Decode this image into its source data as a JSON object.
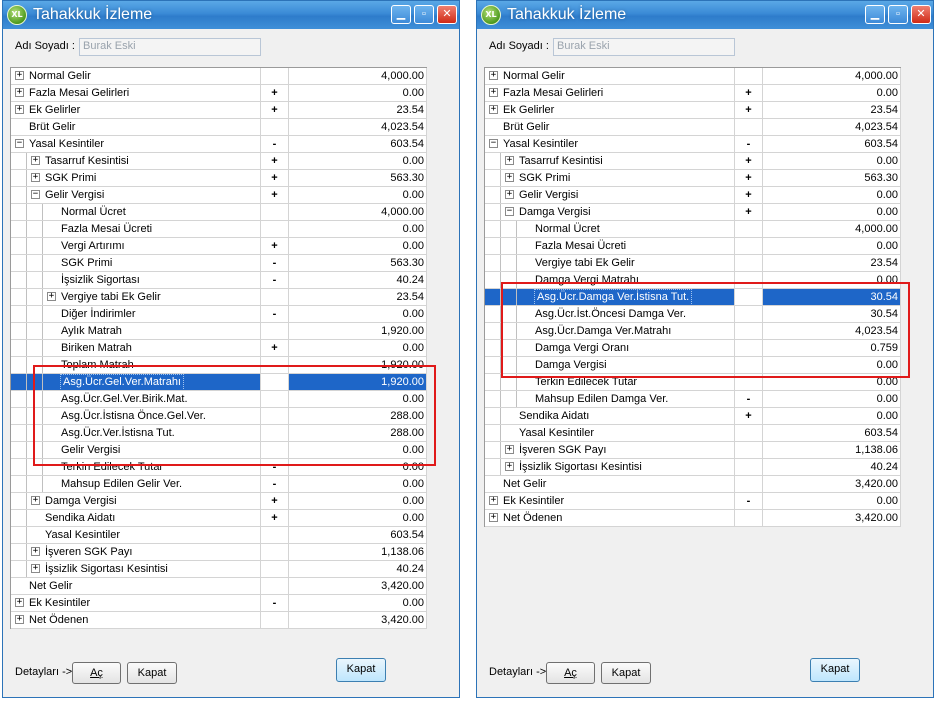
{
  "windows": [
    {
      "title": "Tahakkuk İzleme",
      "name_label": "Adı Soyadı :",
      "name_value": "Burak Eski",
      "footer_label": "Detayları ->",
      "btn_open": "Aç",
      "btn_collapse": "Kapat",
      "btn_close": "Kapat",
      "rows": [
        {
          "name": "Normal Gelir",
          "sign": "",
          "value": "4,000.00",
          "level": 0,
          "exp": "+"
        },
        {
          "name": "Fazla Mesai Gelirleri",
          "sign": "+",
          "value": "0.00",
          "level": 0,
          "exp": "+"
        },
        {
          "name": "Ek Gelirler",
          "sign": "+",
          "value": "23.54",
          "level": 0,
          "exp": "+"
        },
        {
          "name": "Brüt Gelir",
          "sign": "",
          "value": "4,023.54",
          "level": 0,
          "exp": ""
        },
        {
          "name": "Yasal Kesintiler",
          "sign": "-",
          "value": "603.54",
          "level": 0,
          "exp": "-"
        },
        {
          "name": "Tasarruf Kesintisi",
          "sign": "+",
          "value": "0.00",
          "level": 1,
          "exp": "+"
        },
        {
          "name": "SGK Primi",
          "sign": "+",
          "value": "563.30",
          "level": 1,
          "exp": "+"
        },
        {
          "name": "Gelir Vergisi",
          "sign": "+",
          "value": "0.00",
          "level": 1,
          "exp": "-"
        },
        {
          "name": "Normal Ücret",
          "sign": "",
          "value": "4,000.00",
          "level": 2,
          "exp": ""
        },
        {
          "name": "Fazla Mesai Ücreti",
          "sign": "",
          "value": "0.00",
          "level": 2,
          "exp": ""
        },
        {
          "name": "Vergi Artırımı",
          "sign": "+",
          "value": "0.00",
          "level": 2,
          "exp": ""
        },
        {
          "name": "SGK Primi",
          "sign": "-",
          "value": "563.30",
          "level": 2,
          "exp": ""
        },
        {
          "name": "İşsizlik Sigortası",
          "sign": "-",
          "value": "40.24",
          "level": 2,
          "exp": ""
        },
        {
          "name": "Vergiye tabi Ek Gelir",
          "sign": "",
          "value": "23.54",
          "level": 2,
          "exp": "+"
        },
        {
          "name": "Diğer İndirimler",
          "sign": "-",
          "value": "0.00",
          "level": 2,
          "exp": ""
        },
        {
          "name": "Aylık Matrah",
          "sign": "",
          "value": "1,920.00",
          "level": 2,
          "exp": ""
        },
        {
          "name": "Biriken Matrah",
          "sign": "+",
          "value": "0.00",
          "level": 2,
          "exp": ""
        },
        {
          "name": "Toplam Matrah",
          "sign": "",
          "value": "1,920.00",
          "level": 2,
          "exp": ""
        },
        {
          "name": "Asg.Ücr.Gel.Ver.Matrahı",
          "sign": "",
          "value": "1,920.00",
          "level": 2,
          "exp": "",
          "selected": true
        },
        {
          "name": "Asg.Ücr.Gel.Ver.Birik.Mat.",
          "sign": "",
          "value": "0.00",
          "level": 2,
          "exp": ""
        },
        {
          "name": "Asg.Ücr.İstisna Önce.Gel.Ver.",
          "sign": "",
          "value": "288.00",
          "level": 2,
          "exp": ""
        },
        {
          "name": "Asg.Ücr.Ver.İstisna Tut.",
          "sign": "",
          "value": "288.00",
          "level": 2,
          "exp": ""
        },
        {
          "name": "Gelir Vergisi",
          "sign": "",
          "value": "0.00",
          "level": 2,
          "exp": ""
        },
        {
          "name": "Terkin Edilecek Tutar",
          "sign": "-",
          "value": "0.00",
          "level": 2,
          "exp": ""
        },
        {
          "name": "Mahsup Edilen Gelir Ver.",
          "sign": "-",
          "value": "0.00",
          "level": 2,
          "exp": ""
        },
        {
          "name": "Damga Vergisi",
          "sign": "+",
          "value": "0.00",
          "level": 1,
          "exp": "+"
        },
        {
          "name": "Sendika Aidatı",
          "sign": "+",
          "value": "0.00",
          "level": 1,
          "exp": ""
        },
        {
          "name": "Yasal Kesintiler",
          "sign": "",
          "value": "603.54",
          "level": 1,
          "exp": ""
        },
        {
          "name": "İşveren SGK Payı",
          "sign": "",
          "value": "1,138.06",
          "level": 1,
          "exp": "+"
        },
        {
          "name": "İşsizlik Sigortası Kesintisi",
          "sign": "",
          "value": "40.24",
          "level": 1,
          "exp": "+"
        },
        {
          "name": "Net Gelir",
          "sign": "",
          "value": "3,420.00",
          "level": 0,
          "exp": ""
        },
        {
          "name": "Ek Kesintiler",
          "sign": "-",
          "value": "0.00",
          "level": 0,
          "exp": "+"
        },
        {
          "name": "Net Ödenen",
          "sign": "",
          "value": "3,420.00",
          "level": 0,
          "exp": "+"
        }
      ]
    },
    {
      "title": "Tahakkuk İzleme",
      "name_label": "Adı Soyadı :",
      "name_value": "Burak Eski",
      "footer_label": "Detayları ->",
      "btn_open": "Aç",
      "btn_collapse": "Kapat",
      "btn_close": "Kapat",
      "rows": [
        {
          "name": "Normal Gelir",
          "sign": "",
          "value": "4,000.00",
          "level": 0,
          "exp": "+"
        },
        {
          "name": "Fazla Mesai Gelirleri",
          "sign": "+",
          "value": "0.00",
          "level": 0,
          "exp": "+"
        },
        {
          "name": "Ek Gelirler",
          "sign": "+",
          "value": "23.54",
          "level": 0,
          "exp": "+"
        },
        {
          "name": "Brüt Gelir",
          "sign": "",
          "value": "4,023.54",
          "level": 0,
          "exp": ""
        },
        {
          "name": "Yasal Kesintiler",
          "sign": "-",
          "value": "603.54",
          "level": 0,
          "exp": "-"
        },
        {
          "name": "Tasarruf Kesintisi",
          "sign": "+",
          "value": "0.00",
          "level": 1,
          "exp": "+"
        },
        {
          "name": "SGK Primi",
          "sign": "+",
          "value": "563.30",
          "level": 1,
          "exp": "+"
        },
        {
          "name": "Gelir Vergisi",
          "sign": "+",
          "value": "0.00",
          "level": 1,
          "exp": "+"
        },
        {
          "name": "Damga Vergisi",
          "sign": "+",
          "value": "0.00",
          "level": 1,
          "exp": "-"
        },
        {
          "name": "Normal Ücret",
          "sign": "",
          "value": "4,000.00",
          "level": 2,
          "exp": ""
        },
        {
          "name": "Fazla Mesai Ücreti",
          "sign": "",
          "value": "0.00",
          "level": 2,
          "exp": ""
        },
        {
          "name": "Vergiye tabi Ek Gelir",
          "sign": "",
          "value": "23.54",
          "level": 2,
          "exp": ""
        },
        {
          "name": "Damga Vergi Matrahı",
          "sign": "",
          "value": "0.00",
          "level": 2,
          "exp": ""
        },
        {
          "name": "Asg.Ücr.Damga Ver.İstisna Tut.",
          "sign": "",
          "value": "30.54",
          "level": 2,
          "exp": "",
          "selected": true
        },
        {
          "name": "Asg.Ücr.İst.Öncesi Damga Ver.",
          "sign": "",
          "value": "30.54",
          "level": 2,
          "exp": ""
        },
        {
          "name": "Asg.Ücr.Damga Ver.Matrahı",
          "sign": "",
          "value": "4,023.54",
          "level": 2,
          "exp": ""
        },
        {
          "name": "Damga Vergi Oranı",
          "sign": "",
          "value": "0.759",
          "level": 2,
          "exp": ""
        },
        {
          "name": "Damga Vergisi",
          "sign": "",
          "value": "0.00",
          "level": 2,
          "exp": ""
        },
        {
          "name": "Terkin Edilecek Tutar",
          "sign": "",
          "value": "0.00",
          "level": 2,
          "exp": ""
        },
        {
          "name": "Mahsup Edilen Damga Ver.",
          "sign": "-",
          "value": "0.00",
          "level": 2,
          "exp": ""
        },
        {
          "name": "Sendika Aidatı",
          "sign": "+",
          "value": "0.00",
          "level": 1,
          "exp": ""
        },
        {
          "name": "Yasal Kesintiler",
          "sign": "",
          "value": "603.54",
          "level": 1,
          "exp": ""
        },
        {
          "name": "İşveren SGK Payı",
          "sign": "",
          "value": "1,138.06",
          "level": 1,
          "exp": "+"
        },
        {
          "name": "İşsizlik Sigortası Kesintisi",
          "sign": "",
          "value": "40.24",
          "level": 1,
          "exp": "+"
        },
        {
          "name": "Net Gelir",
          "sign": "",
          "value": "3,420.00",
          "level": 0,
          "exp": ""
        },
        {
          "name": "Ek Kesintiler",
          "sign": "-",
          "value": "0.00",
          "level": 0,
          "exp": "+"
        },
        {
          "name": "Net Ödenen",
          "sign": "",
          "value": "3,420.00",
          "level": 0,
          "exp": "+"
        }
      ]
    }
  ],
  "colors": {
    "selection": "#1e66c8",
    "highlight_box": "#e01a1a",
    "titlebar": "#3a8ad6"
  },
  "icons": {
    "app_logo": "xl-logo-icon",
    "expand": "plus-box-icon",
    "collapse": "minus-box-icon"
  }
}
